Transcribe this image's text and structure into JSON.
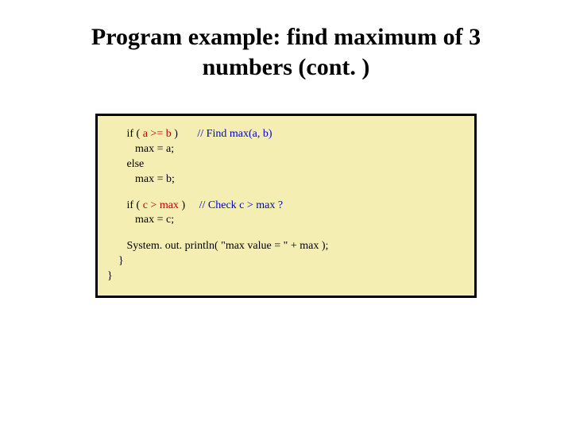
{
  "slide": {
    "title_line1": "Program example: find maximum of 3",
    "title_line2": "numbers (cont. )"
  },
  "code": {
    "l1_pre": "       if ( ",
    "l1_cond": "a >= b",
    "l1_post": " )       ",
    "l1_comment": "// Find max(a, b)",
    "l2": "          max = a;",
    "l3": "       else",
    "l4": "          max = b;",
    "l5_pre": "       if ( ",
    "l5_cond": "c > max",
    "l5_post": " )     ",
    "l5_comment": "// Check c > max ?",
    "l6": "          max = c;",
    "l7": "       System. out. println( \"max value = \" + max );",
    "l8": "    }",
    "l9": "}"
  }
}
